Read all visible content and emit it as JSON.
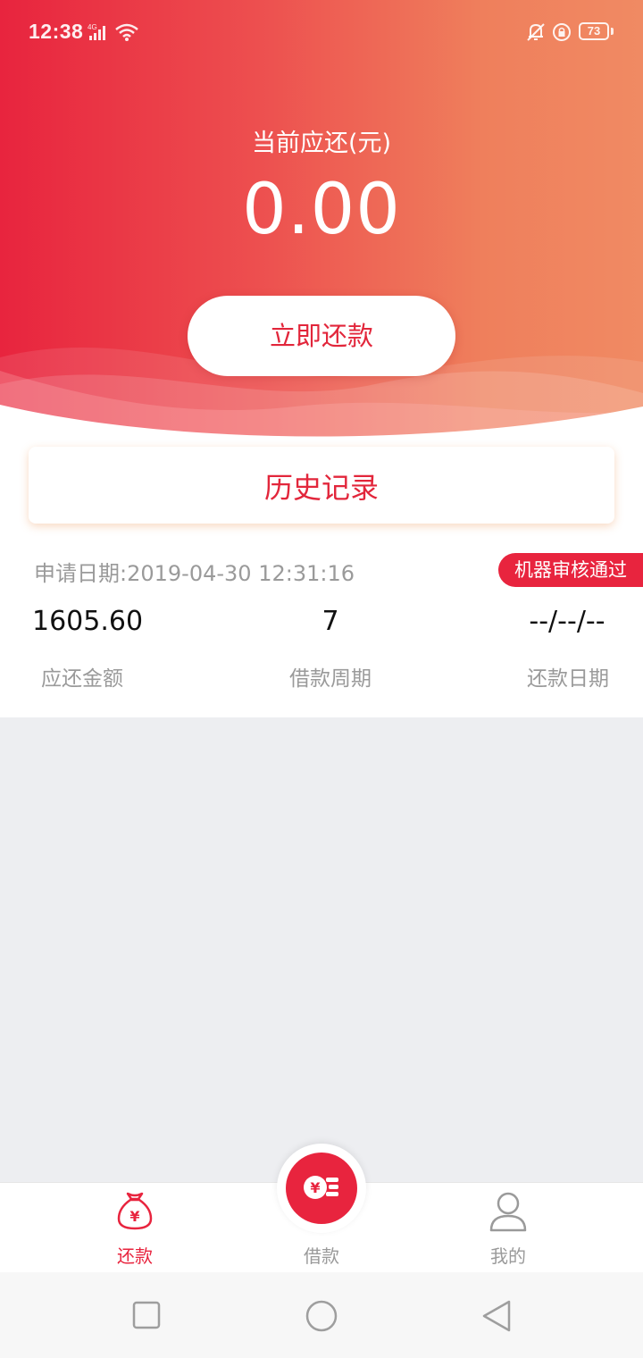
{
  "status_bar": {
    "time": "12:38",
    "network": "4G",
    "battery": "73",
    "icons": [
      "signal-icon",
      "wifi-icon",
      "bell-muted-icon",
      "rotation-lock-icon",
      "battery-icon"
    ]
  },
  "header": {
    "due_label": "当前应还(元)",
    "due_amount": "0.00",
    "repay_button_label": "立即还款"
  },
  "history": {
    "title": "历史记录"
  },
  "loan_record": {
    "apply_date_label": "申请日期:",
    "apply_date_value": "2019-04-30 12:31:16",
    "status_badge": "机器审核通过",
    "amount_due": "1605.60",
    "amount_due_label": "应还金额",
    "loan_period": "7",
    "loan_period_label": "借款周期",
    "repay_date": "--/--/--",
    "repay_date_label": "还款日期"
  },
  "tabbar": {
    "tabs": [
      {
        "label": "还款",
        "icon": "money-bag-icon",
        "active": true
      },
      {
        "label": "借款",
        "icon": "coin-stack-icon",
        "active": false
      },
      {
        "label": "我的",
        "icon": "user-icon",
        "active": false
      }
    ]
  },
  "colors": {
    "primary": "#e8243e",
    "gradient_end": "#f08a63",
    "muted_text": "#9a9a9a"
  },
  "system_nav": {
    "icons": [
      "recent-apps-icon",
      "home-icon",
      "back-icon"
    ]
  }
}
